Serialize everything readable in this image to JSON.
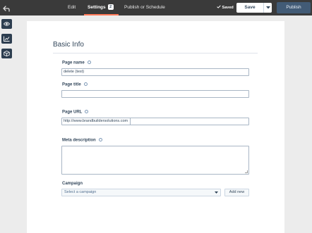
{
  "topbar": {
    "tabs": [
      {
        "label": "Edit"
      },
      {
        "label": "Settings",
        "badge": "2",
        "active": true
      },
      {
        "label": "Publish or Schedule"
      }
    ],
    "saved_label": "Saved",
    "save_label": "Save",
    "publish_label": "Publish",
    "accent_color": "#ff7a59"
  },
  "rail": {
    "icons": [
      "eye-icon",
      "chart-icon",
      "box-icon"
    ]
  },
  "form": {
    "section_title": "Basic Info",
    "page_name": {
      "label": "Page name",
      "value": "delete (test)"
    },
    "page_title": {
      "label": "Page title",
      "value": ""
    },
    "page_url": {
      "label": "Page URL",
      "prefix": "http://www.brandbuildersolutions.com",
      "value": ""
    },
    "meta_description": {
      "label": "Meta description",
      "value": ""
    },
    "campaign": {
      "label": "Campaign",
      "placeholder": "Select a campaign",
      "add_label": "Add new"
    }
  }
}
